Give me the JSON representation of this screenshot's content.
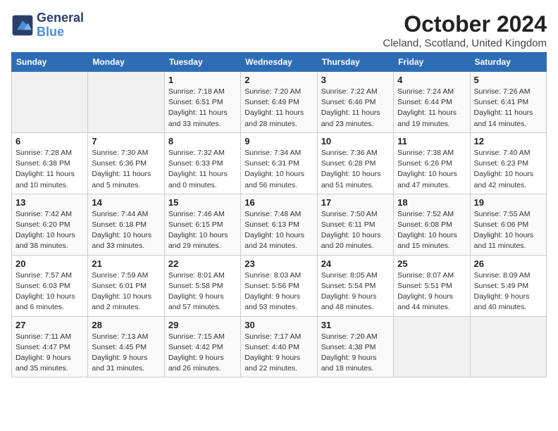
{
  "header": {
    "logo_line1": "General",
    "logo_line2": "Blue",
    "title": "October 2024",
    "subtitle": "Cleland, Scotland, United Kingdom"
  },
  "days_of_week": [
    "Sunday",
    "Monday",
    "Tuesday",
    "Wednesday",
    "Thursday",
    "Friday",
    "Saturday"
  ],
  "weeks": [
    [
      {
        "num": "",
        "detail": ""
      },
      {
        "num": "",
        "detail": ""
      },
      {
        "num": "1",
        "detail": "Sunrise: 7:18 AM\nSunset: 6:51 PM\nDaylight: 11 hours\nand 33 minutes."
      },
      {
        "num": "2",
        "detail": "Sunrise: 7:20 AM\nSunset: 6:49 PM\nDaylight: 11 hours\nand 28 minutes."
      },
      {
        "num": "3",
        "detail": "Sunrise: 7:22 AM\nSunset: 6:46 PM\nDaylight: 11 hours\nand 23 minutes."
      },
      {
        "num": "4",
        "detail": "Sunrise: 7:24 AM\nSunset: 6:44 PM\nDaylight: 11 hours\nand 19 minutes."
      },
      {
        "num": "5",
        "detail": "Sunrise: 7:26 AM\nSunset: 6:41 PM\nDaylight: 11 hours\nand 14 minutes."
      }
    ],
    [
      {
        "num": "6",
        "detail": "Sunrise: 7:28 AM\nSunset: 6:38 PM\nDaylight: 11 hours\nand 10 minutes."
      },
      {
        "num": "7",
        "detail": "Sunrise: 7:30 AM\nSunset: 6:36 PM\nDaylight: 11 hours\nand 5 minutes."
      },
      {
        "num": "8",
        "detail": "Sunrise: 7:32 AM\nSunset: 6:33 PM\nDaylight: 11 hours\nand 0 minutes."
      },
      {
        "num": "9",
        "detail": "Sunrise: 7:34 AM\nSunset: 6:31 PM\nDaylight: 10 hours\nand 56 minutes."
      },
      {
        "num": "10",
        "detail": "Sunrise: 7:36 AM\nSunset: 6:28 PM\nDaylight: 10 hours\nand 51 minutes."
      },
      {
        "num": "11",
        "detail": "Sunrise: 7:38 AM\nSunset: 6:26 PM\nDaylight: 10 hours\nand 47 minutes."
      },
      {
        "num": "12",
        "detail": "Sunrise: 7:40 AM\nSunset: 6:23 PM\nDaylight: 10 hours\nand 42 minutes."
      }
    ],
    [
      {
        "num": "13",
        "detail": "Sunrise: 7:42 AM\nSunset: 6:20 PM\nDaylight: 10 hours\nand 38 minutes."
      },
      {
        "num": "14",
        "detail": "Sunrise: 7:44 AM\nSunset: 6:18 PM\nDaylight: 10 hours\nand 33 minutes."
      },
      {
        "num": "15",
        "detail": "Sunrise: 7:46 AM\nSunset: 6:15 PM\nDaylight: 10 hours\nand 29 minutes."
      },
      {
        "num": "16",
        "detail": "Sunrise: 7:48 AM\nSunset: 6:13 PM\nDaylight: 10 hours\nand 24 minutes."
      },
      {
        "num": "17",
        "detail": "Sunrise: 7:50 AM\nSunset: 6:11 PM\nDaylight: 10 hours\nand 20 minutes."
      },
      {
        "num": "18",
        "detail": "Sunrise: 7:52 AM\nSunset: 6:08 PM\nDaylight: 10 hours\nand 15 minutes."
      },
      {
        "num": "19",
        "detail": "Sunrise: 7:55 AM\nSunset: 6:06 PM\nDaylight: 10 hours\nand 11 minutes."
      }
    ],
    [
      {
        "num": "20",
        "detail": "Sunrise: 7:57 AM\nSunset: 6:03 PM\nDaylight: 10 hours\nand 6 minutes."
      },
      {
        "num": "21",
        "detail": "Sunrise: 7:59 AM\nSunset: 6:01 PM\nDaylight: 10 hours\nand 2 minutes."
      },
      {
        "num": "22",
        "detail": "Sunrise: 8:01 AM\nSunset: 5:58 PM\nDaylight: 9 hours\nand 57 minutes."
      },
      {
        "num": "23",
        "detail": "Sunrise: 8:03 AM\nSunset: 5:56 PM\nDaylight: 9 hours\nand 53 minutes."
      },
      {
        "num": "24",
        "detail": "Sunrise: 8:05 AM\nSunset: 5:54 PM\nDaylight: 9 hours\nand 48 minutes."
      },
      {
        "num": "25",
        "detail": "Sunrise: 8:07 AM\nSunset: 5:51 PM\nDaylight: 9 hours\nand 44 minutes."
      },
      {
        "num": "26",
        "detail": "Sunrise: 8:09 AM\nSunset: 5:49 PM\nDaylight: 9 hours\nand 40 minutes."
      }
    ],
    [
      {
        "num": "27",
        "detail": "Sunrise: 7:11 AM\nSunset: 4:47 PM\nDaylight: 9 hours\nand 35 minutes."
      },
      {
        "num": "28",
        "detail": "Sunrise: 7:13 AM\nSunset: 4:45 PM\nDaylight: 9 hours\nand 31 minutes."
      },
      {
        "num": "29",
        "detail": "Sunrise: 7:15 AM\nSunset: 4:42 PM\nDaylight: 9 hours\nand 26 minutes."
      },
      {
        "num": "30",
        "detail": "Sunrise: 7:17 AM\nSunset: 4:40 PM\nDaylight: 9 hours\nand 22 minutes."
      },
      {
        "num": "31",
        "detail": "Sunrise: 7:20 AM\nSunset: 4:38 PM\nDaylight: 9 hours\nand 18 minutes."
      },
      {
        "num": "",
        "detail": ""
      },
      {
        "num": "",
        "detail": ""
      }
    ]
  ]
}
